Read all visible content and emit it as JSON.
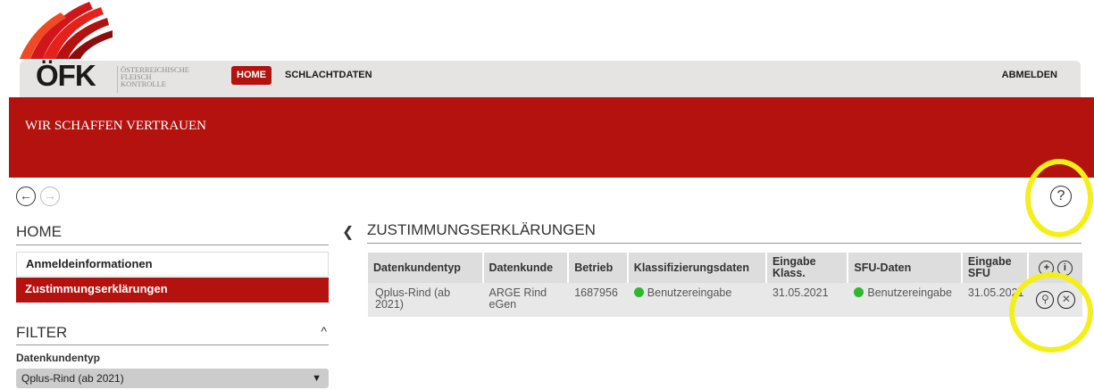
{
  "header": {
    "logo_text": "ÖFK",
    "org_name_lines": [
      "ÖSTERREICHISCHE",
      "FLEISCH",
      "KONTROLLE"
    ],
    "nav": {
      "home": "HOME",
      "schlachtdaten": "SCHLACHTDATEN",
      "logout": "ABMELDEN"
    },
    "slogan": "WIR SCHAFFEN VERTRAUEN",
    "colors": {
      "brand_red": "#b3120e",
      "nav_bg": "#e6e3e3",
      "highlight": "#f4ef19"
    }
  },
  "toolbar": {
    "back_icon": "arrow-left-circle-icon",
    "forward_icon": "arrow-right-circle-icon",
    "help_icon": "question-circle-icon",
    "back_glyph": "←",
    "forward_glyph": "→",
    "help_glyph": "?"
  },
  "sidebar": {
    "title": "HOME",
    "items": [
      {
        "label": "Anmeldeinformationen",
        "active": false
      },
      {
        "label": "Zustimmungserklärungen",
        "active": true
      }
    ],
    "filter": {
      "title": "FILTER",
      "field_label": "Datenkundentyp",
      "selected_value": "Qplus-Rind (ab 2021)"
    }
  },
  "main": {
    "title": "ZUSTIMMUNGSERKLÄRUNGEN",
    "table": {
      "headers": [
        "Datenkundentyp",
        "Datenkunde",
        "Betrieb",
        "Klassifizierungsdaten",
        "Eingabe Klass.",
        "SFU-Daten",
        "Eingabe SFU"
      ],
      "rows": [
        {
          "datenkundentyp": "Qplus-Rind (ab 2021)",
          "datenkunde": "ARGE Rind eGen",
          "betrieb": "1687956",
          "klassifizierungsdaten": "Benutzereingabe",
          "eingabe_klass": "31.05.2021",
          "sfu_daten": "Benutzereingabe",
          "eingabe_sfu": "31.05.2021",
          "status_color": "#2db82d"
        }
      ]
    }
  }
}
